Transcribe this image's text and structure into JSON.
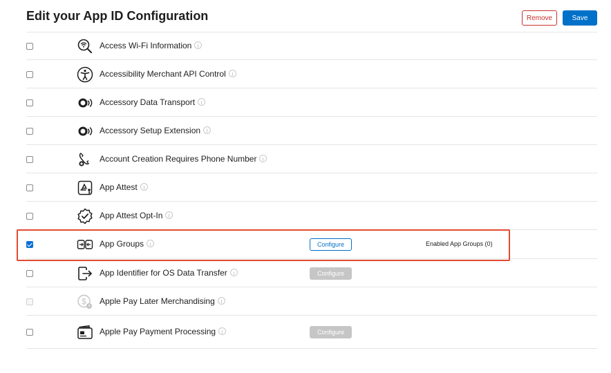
{
  "header": {
    "title": "Edit your App ID Configuration",
    "remove_label": "Remove",
    "save_label": "Save"
  },
  "capabilities": [
    {
      "name": "Access Wi-Fi Information",
      "icon": "wifi-search-icon",
      "checked": false,
      "disabled": false
    },
    {
      "name": "Accessibility Merchant API Control",
      "icon": "accessibility-icon",
      "checked": false,
      "disabled": false
    },
    {
      "name": "Accessory Data Transport",
      "icon": "accessory-transport-icon",
      "checked": false,
      "disabled": false
    },
    {
      "name": "Accessory Setup Extension",
      "icon": "accessory-setup-icon",
      "checked": false,
      "disabled": false
    },
    {
      "name": "Account Creation Requires Phone Number",
      "icon": "phone-account-icon",
      "checked": false,
      "disabled": false
    },
    {
      "name": "App Attest",
      "icon": "app-attest-icon",
      "checked": false,
      "disabled": false
    },
    {
      "name": "App Attest Opt-In",
      "icon": "verified-badge-icon",
      "checked": false,
      "disabled": false
    },
    {
      "name": "App Groups",
      "icon": "app-groups-icon",
      "checked": true,
      "disabled": false,
      "configure": "Configure",
      "configure_enabled": true,
      "status": "Enabled App Groups (0)"
    },
    {
      "name": "App Identifier for OS Data Transfer",
      "icon": "data-transfer-icon",
      "checked": false,
      "disabled": false,
      "configure": "Configure",
      "configure_enabled": false
    },
    {
      "name": "Apple Pay Later Merchandising",
      "icon": "pay-later-icon",
      "checked": false,
      "disabled": true
    },
    {
      "name": "Apple Pay Payment Processing",
      "icon": "wallet-icon",
      "checked": false,
      "disabled": false,
      "configure": "Configure",
      "configure_enabled": false
    }
  ],
  "colors": {
    "accent": "#0070c9",
    "remove": "#c9302c",
    "highlight": "#e24a2f"
  }
}
